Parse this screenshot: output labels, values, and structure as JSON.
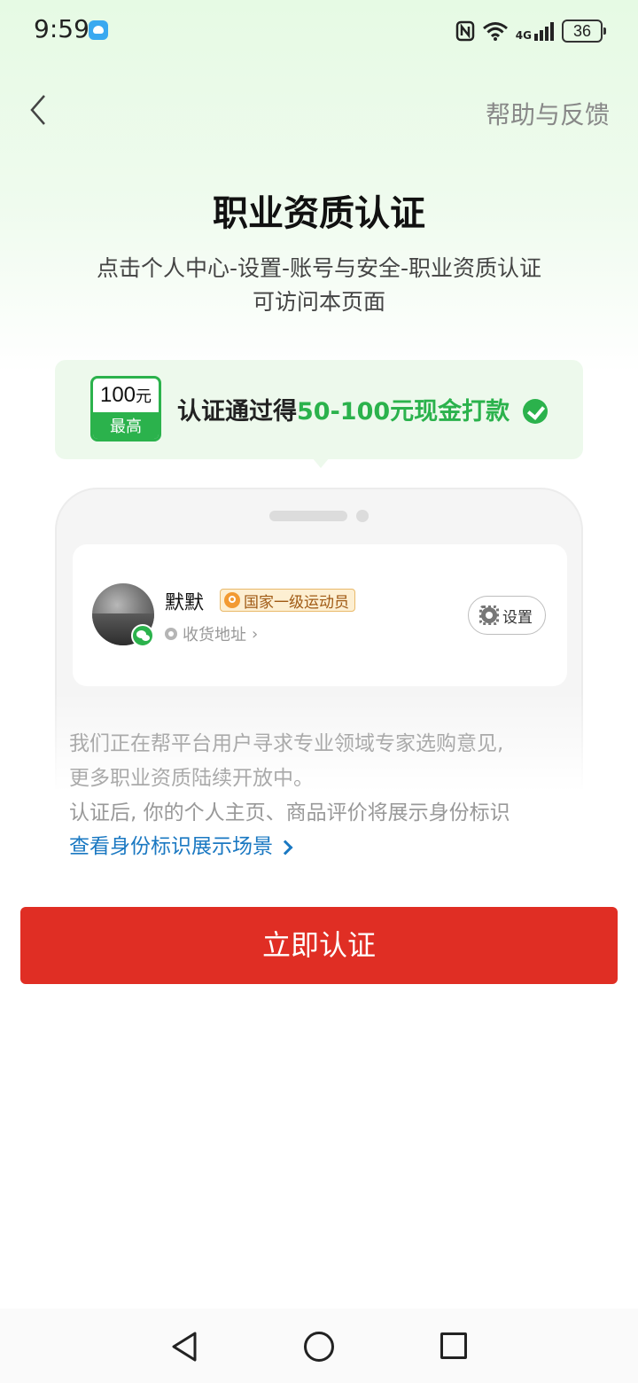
{
  "status_bar": {
    "time": "9:59",
    "network": "4G",
    "battery": "36",
    "icons": [
      "bird-app-icon",
      "nfc-icon",
      "wifi-icon",
      "cellular-signal-icon",
      "battery-icon"
    ]
  },
  "nav": {
    "back_icon": "chevron-left-icon",
    "help_label": "帮助与反馈"
  },
  "header": {
    "title": "职业资质认证",
    "subtitle_line1": "点击个人中心-设置-账号与安全-职业资质认证",
    "subtitle_line2": "可访问本页面"
  },
  "reward": {
    "badge_amount": "100",
    "badge_unit": "元",
    "badge_caption": "最高",
    "text_prefix": "认证通过得",
    "text_highlight": "50-100元现金打款",
    "check_icon": "check-circle-icon",
    "accent_color": "#2bb24c"
  },
  "preview": {
    "user_name": "默默",
    "badge_label": "国家一级运动员",
    "address_label": "收货地址",
    "settings_label": "设置"
  },
  "description": {
    "line1": "我们正在帮平台用户寻求专业领域专家选购意见,",
    "line2": "更多职业资质陆续开放中。",
    "line3": "认证后, 你的个人主页、商品评价将展示身份标识",
    "link": "查看身份标识展示场景"
  },
  "cta": {
    "label": "立即认证",
    "color": "#e02e24"
  },
  "system_nav": {
    "icons": [
      "nav-back-icon",
      "nav-home-icon",
      "nav-recents-icon"
    ]
  }
}
